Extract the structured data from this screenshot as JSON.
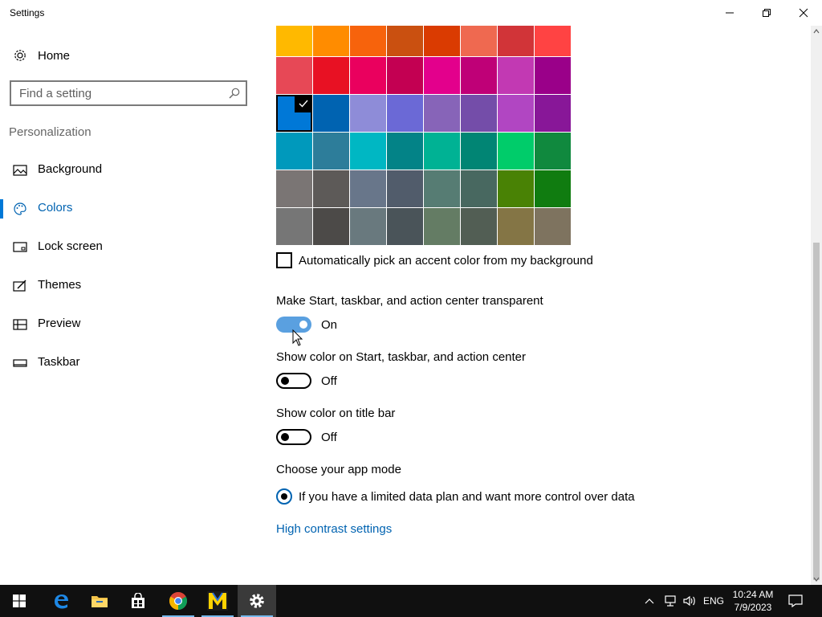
{
  "window": {
    "title": "Settings"
  },
  "sidebar": {
    "home_label": "Home",
    "search_placeholder": "Find a setting",
    "section_title": "Personalization",
    "items": [
      {
        "label": "Background",
        "icon": "picture-icon"
      },
      {
        "label": "Colors",
        "icon": "palette-icon",
        "active": true
      },
      {
        "label": "Lock screen",
        "icon": "lock-screen-icon"
      },
      {
        "label": "Themes",
        "icon": "themes-icon"
      },
      {
        "label": "Preview",
        "icon": "preview-icon"
      },
      {
        "label": "Taskbar",
        "icon": "taskbar-icon"
      }
    ]
  },
  "colors": {
    "swatch_rows": [
      [
        "#ffb900",
        "#ff8c00",
        "#f7630c",
        "#ca5010",
        "#da3b01",
        "#ef6950",
        "#d13438",
        "#ff4343"
      ],
      [
        "#e74856",
        "#e81123",
        "#ea005e",
        "#c30052",
        "#e3008c",
        "#bf0077",
        "#c239b3",
        "#9a0089"
      ],
      [
        "#0078d7",
        "#0063b1",
        "#8e8cd8",
        "#6b69d6",
        "#8764b8",
        "#744da9",
        "#b146c2",
        "#881798"
      ],
      [
        "#0099bc",
        "#2d7d9a",
        "#00b7c3",
        "#038387",
        "#00b294",
        "#018574",
        "#00cc6a",
        "#10893e"
      ],
      [
        "#7a7574",
        "#5d5a58",
        "#68768a",
        "#515c6b",
        "#567c73",
        "#486860",
        "#498205",
        "#107c10"
      ],
      [
        "#767676",
        "#4c4a48",
        "#69797e",
        "#4a5459",
        "#647c64",
        "#525e54",
        "#847545",
        "#7e735f"
      ]
    ],
    "selected": [
      2,
      0
    ],
    "auto_pick_label": "Automatically pick an accent color from my background",
    "transparency": {
      "label": "Make Start, taskbar, and action center transparent",
      "state": "On"
    },
    "show_start": {
      "label": "Show color on Start, taskbar, and action center",
      "state": "Off"
    },
    "show_title": {
      "label": "Show color on title bar",
      "state": "Off"
    },
    "app_mode": {
      "label": "Choose your app mode",
      "option": "If you have a limited data plan and want more control over data"
    },
    "high_contrast_link": "High contrast settings"
  },
  "taskbar": {
    "apps": [
      "start-icon",
      "edge-icon",
      "file-explorer-icon",
      "store-icon",
      "chrome-icon",
      "m-app-icon",
      "settings-icon"
    ],
    "lang": "ENG",
    "time": "10:24 AM",
    "date": "7/9/2023"
  },
  "accent": "#0078d7"
}
